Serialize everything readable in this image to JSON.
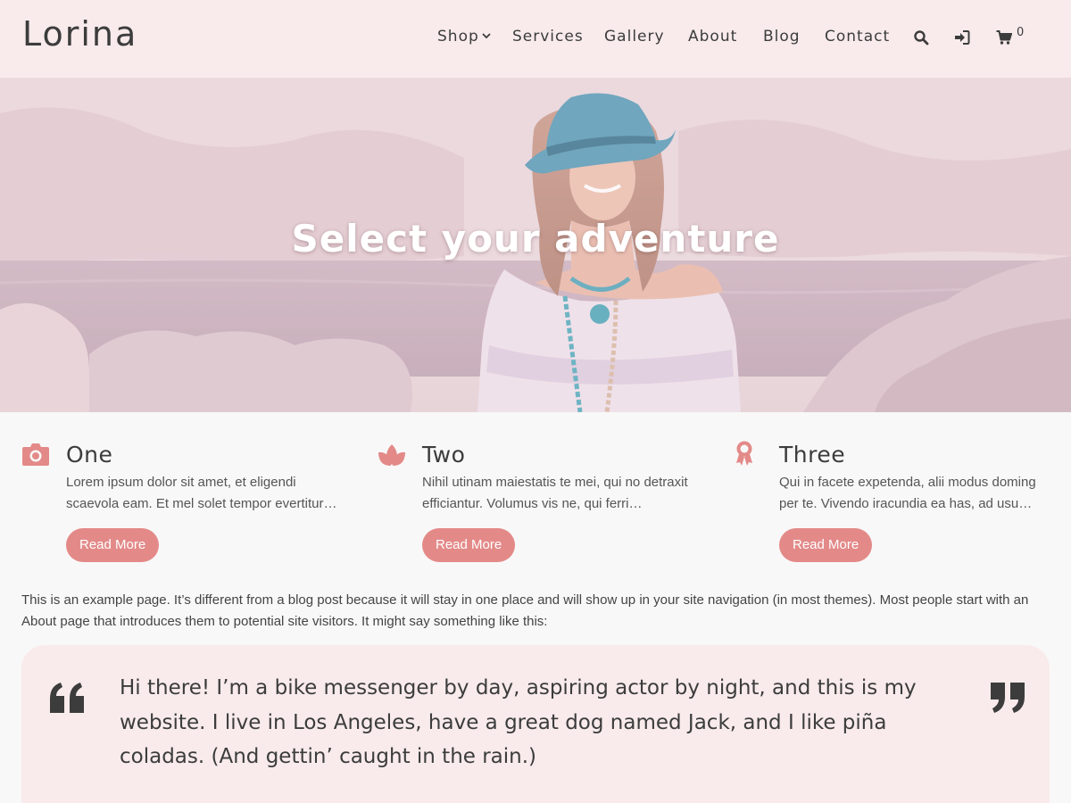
{
  "site": {
    "logo": "Lorina"
  },
  "nav": {
    "items": [
      {
        "label": "Shop"
      },
      {
        "label": "Services"
      },
      {
        "label": "Gallery"
      },
      {
        "label": "About"
      },
      {
        "label": "Blog"
      },
      {
        "label": "Contact"
      }
    ],
    "cart_count": "0",
    "icons": [
      "search-icon",
      "login-icon",
      "cart-icon"
    ]
  },
  "hero": {
    "title": "Select your adventure"
  },
  "features": [
    {
      "icon": "camera-icon",
      "title": "One",
      "text": "Lorem ipsum dolor sit amet, et eligendi scaevola eam. Et mel solet tempor evertitur…",
      "button": "Read More"
    },
    {
      "icon": "lotus-icon",
      "title": "Two",
      "text": "Nihil utinam maiestatis te mei, qui no detraxit efficiantur. Volumus vis ne, qui ferri…",
      "button": "Read More"
    },
    {
      "icon": "award-icon",
      "title": "Three",
      "text": "Qui in facete expetenda, alii modus doming per te. Vivendo iracundia ea has, ad usu…",
      "button": "Read More"
    }
  ],
  "intro": "This is an example page. It’s different from a blog post because it will stay in one place and will show up in your site navigation (in most themes). Most people start with an About page that introduces them to potential site visitors. It might say something like this:",
  "quote": {
    "text": "Hi there! I’m a bike messenger by day, aspiring actor by night, and this is my website. I live in Los Angeles, have a great dog named Jack, and I like piña coladas. (And gettin’ caught in the rain.)"
  },
  "colors": {
    "accent": "#e38a89",
    "header_bg": "#f9ebeb",
    "text_dark": "#3c3c3c"
  }
}
